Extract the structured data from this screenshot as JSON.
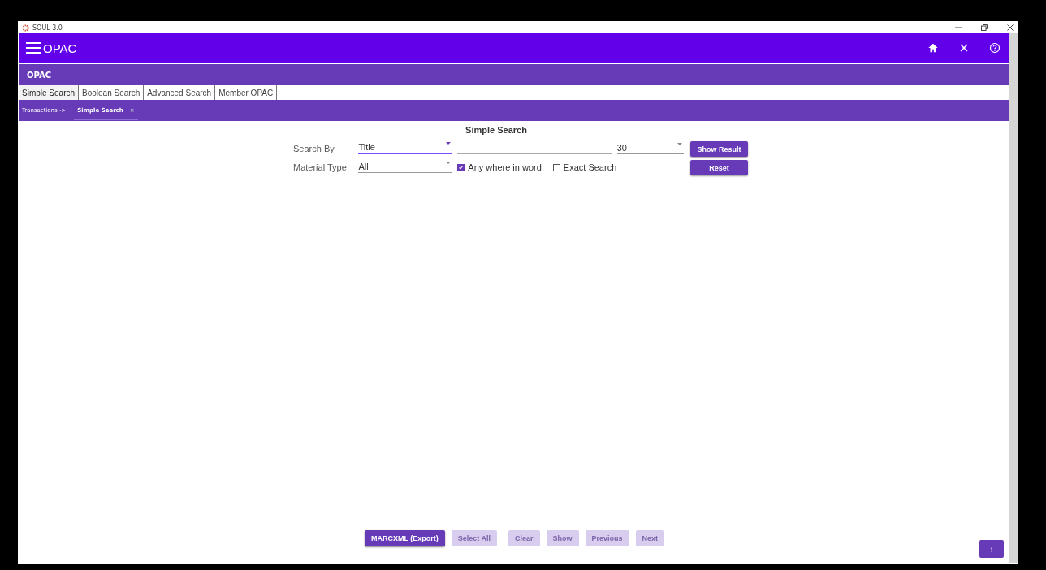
{
  "window": {
    "title": "SOUL 3.0"
  },
  "app_bar": {
    "title": "OPAC"
  },
  "section_bar": {
    "title": "OPAC"
  },
  "tabs": [
    {
      "label": "Simple Search",
      "selected": true
    },
    {
      "label": "Boolean Search",
      "selected": false
    },
    {
      "label": "Advanced Search",
      "selected": false
    },
    {
      "label": "Member OPAC",
      "selected": false
    }
  ],
  "breadcrumb": {
    "parent": "Transactions ->",
    "current": "Simple Search",
    "close": "×"
  },
  "form": {
    "title": "Simple Search",
    "search_by": {
      "label": "Search By",
      "value": "Title"
    },
    "count": {
      "value": "30"
    },
    "material_type": {
      "label": "Material Type",
      "value": "All"
    },
    "options": [
      {
        "label": "Any where in word",
        "checked": true
      },
      {
        "label": "Exact Search",
        "checked": false
      }
    ],
    "buttons": [
      "Show Result",
      "Reset"
    ]
  },
  "bottom_buttons": [
    {
      "label": "MARCXML (Export)",
      "disabled": false
    },
    {
      "label": "Select All",
      "disabled": true
    },
    {
      "label": "Clear",
      "disabled": true
    },
    {
      "label": "Show",
      "disabled": true
    },
    {
      "label": "Previous",
      "disabled": true
    },
    {
      "label": "Next",
      "disabled": true
    }
  ],
  "scroll_top": {
    "label": "↑"
  }
}
